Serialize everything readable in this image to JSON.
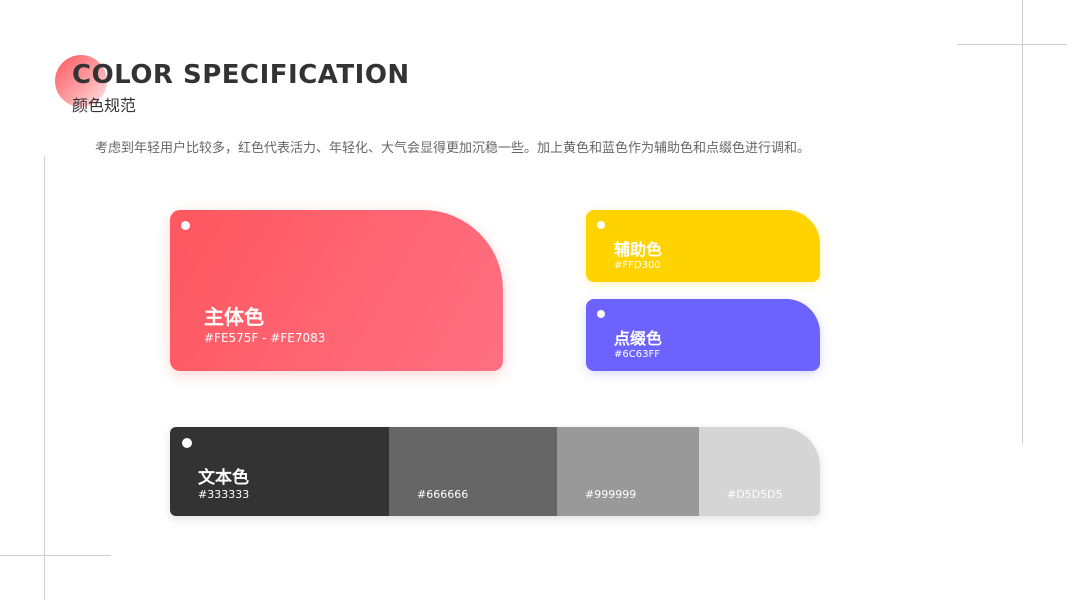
{
  "header": {
    "title_en": "COLOR SPECIFICATION",
    "title_cn": "颜色规范",
    "description": "考虑到年轻用户比较多，红色代表活力、年轻化、大气会显得更加沉稳一些。加上黄色和蓝色作为辅助色和点缀色进行调和。"
  },
  "colors": {
    "primary": {
      "label": "主体色",
      "hex": "#FE575F - #FE7083"
    },
    "secondary": {
      "label": "辅助色",
      "hex": "#FFD300"
    },
    "accent": {
      "label": "点缀色",
      "hex": "#6C63FF"
    },
    "text": {
      "label": "文本色",
      "swatches": [
        {
          "hex": "#333333"
        },
        {
          "hex": "#666666"
        },
        {
          "hex": "#999999"
        },
        {
          "hex": "#D5D5D5"
        }
      ]
    }
  }
}
